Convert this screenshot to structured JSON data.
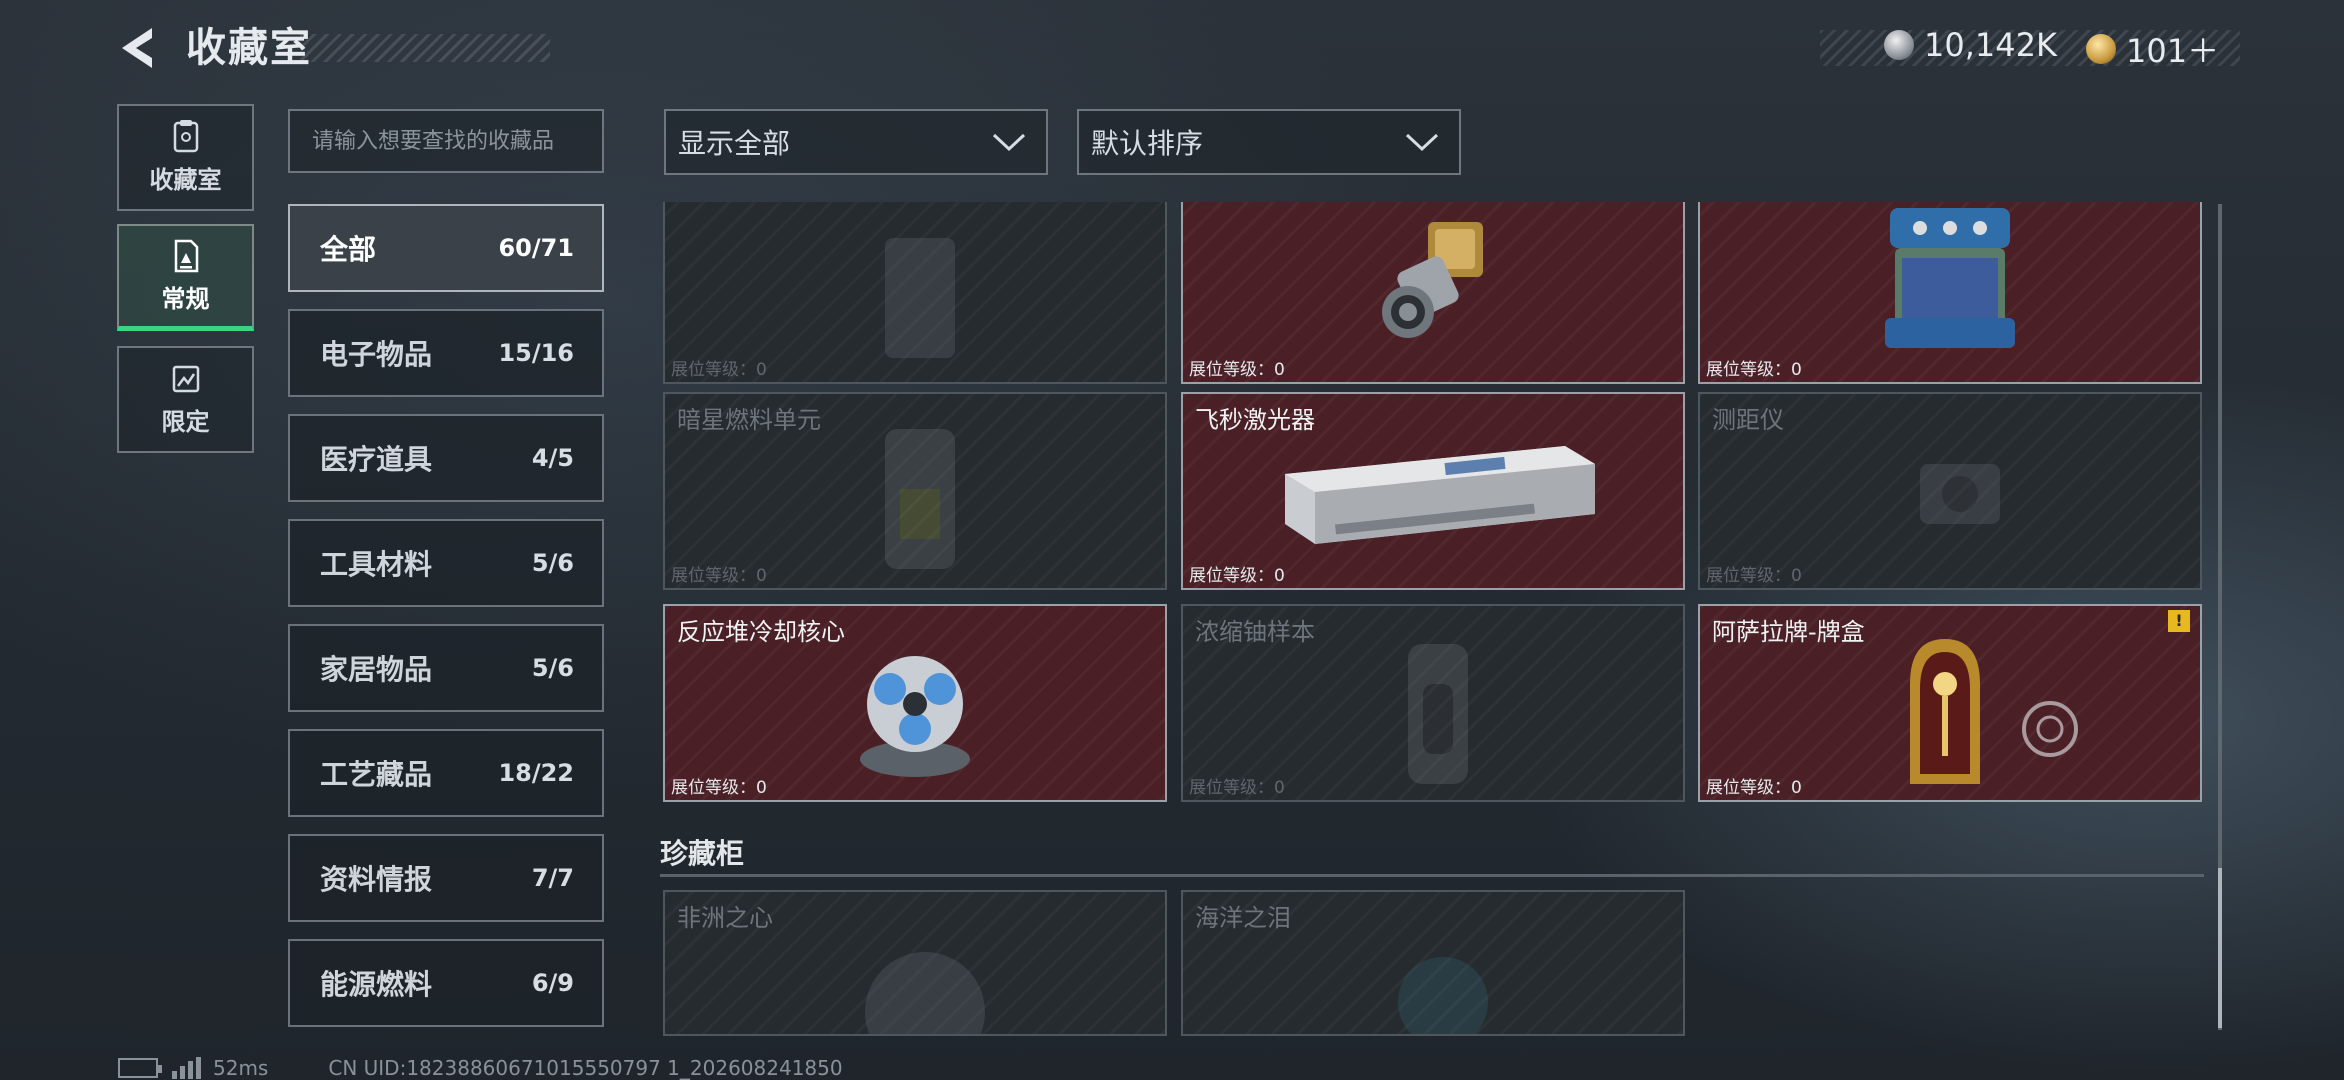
{
  "header": {
    "title": "收藏室",
    "back_icon": "back-arrow-icon",
    "currencies": [
      {
        "icon": "silver-coin-icon",
        "value": "10,142K"
      },
      {
        "icon": "gold-coin-icon",
        "value": "101＋"
      }
    ]
  },
  "side_tabs": [
    {
      "label": "收藏室",
      "icon": "collection-room-icon",
      "active": false
    },
    {
      "label": "常规",
      "icon": "regular-icon",
      "active": true
    },
    {
      "label": "限定",
      "icon": "limited-icon",
      "active": false
    }
  ],
  "search": {
    "placeholder": "请输入想要查找的收藏品",
    "value": ""
  },
  "filters": {
    "display": "显示全部",
    "sort": "默认排序"
  },
  "categories": [
    {
      "name": "全部",
      "count": "60/71",
      "active": true
    },
    {
      "name": "电子物品",
      "count": "15/16",
      "active": false
    },
    {
      "name": "医疗道具",
      "count": "4/5",
      "active": false
    },
    {
      "name": "工具材料",
      "count": "5/6",
      "active": false
    },
    {
      "name": "家居物品",
      "count": "5/6",
      "active": false
    },
    {
      "name": "工艺藏品",
      "count": "18/22",
      "active": false
    },
    {
      "name": "资料情报",
      "count": "7/7",
      "active": false
    },
    {
      "name": "能源燃料",
      "count": "6/9",
      "active": false
    }
  ],
  "items": [
    {
      "name": "",
      "level": "展位等级：0",
      "owned": false
    },
    {
      "name": "",
      "level": "展位等级：0",
      "owned": true
    },
    {
      "name": "",
      "level": "展位等级：0",
      "owned": true
    },
    {
      "name": "暗星燃料单元",
      "level": "展位等级：0",
      "owned": false
    },
    {
      "name": "飞秒激光器",
      "level": "展位等级：0",
      "owned": true
    },
    {
      "name": "测距仪",
      "level": "展位等级：0",
      "owned": false
    },
    {
      "name": "反应堆冷却核心",
      "level": "展位等级：0",
      "owned": true
    },
    {
      "name": "浓缩铀样本",
      "level": "展位等级：0",
      "owned": false
    },
    {
      "name": "阿萨拉牌-牌盒",
      "level": "展位等级：0",
      "owned": true,
      "alert": "!"
    }
  ],
  "section": {
    "title": "珍藏柜",
    "items": [
      {
        "name": "非洲之心",
        "owned": false
      },
      {
        "name": "海洋之泪",
        "owned": false
      }
    ]
  },
  "footer": {
    "ping": "52ms",
    "uid": "CN UID:18238860671015550797 1_202608241850"
  },
  "colors": {
    "owned_card": "#4a2026",
    "active_accent": "#39d67d",
    "alert": "#e8b81f"
  }
}
